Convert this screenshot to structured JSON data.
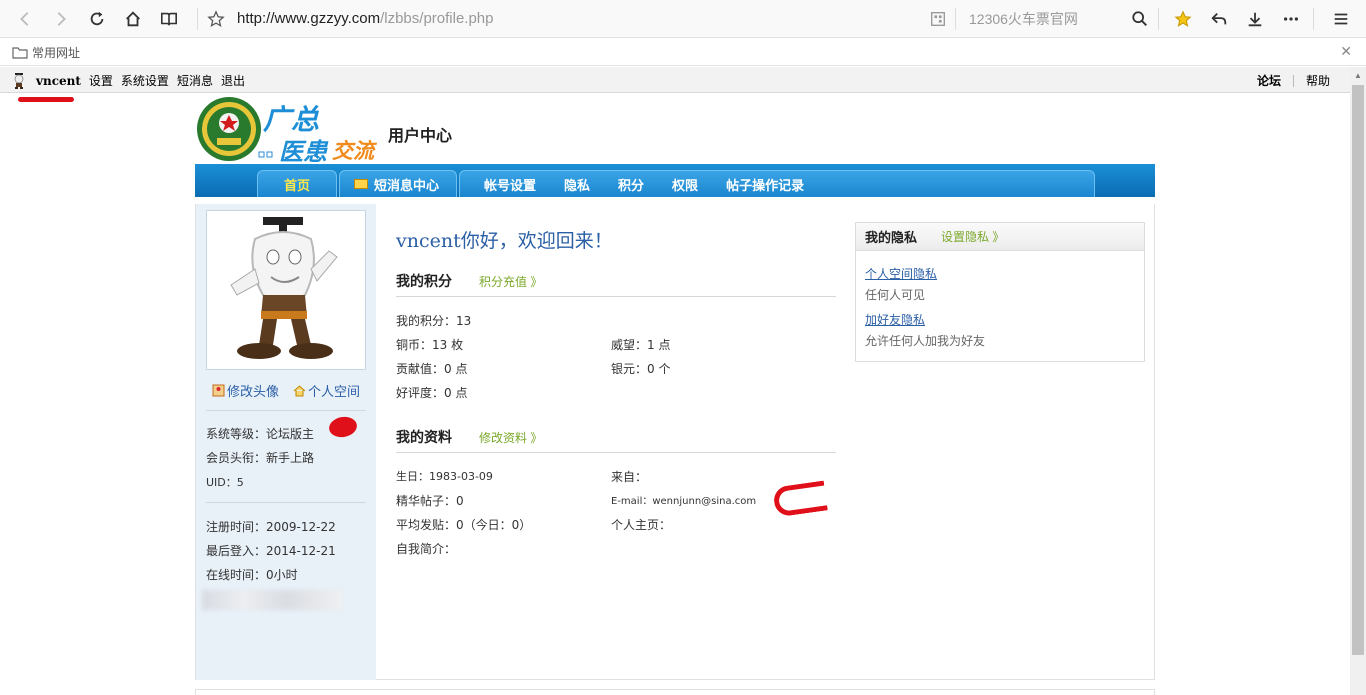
{
  "browser": {
    "url_host": "http://www.gzzyy.com",
    "url_path": "/lzbbs/profile.php",
    "search_placeholder": "12306火车票官网",
    "bookmark_folder": "常用网址"
  },
  "topbar": {
    "username": "vncent",
    "links": [
      "设置",
      "系统设置",
      "短消息",
      "退出"
    ],
    "right_links": [
      "论坛",
      "帮助"
    ]
  },
  "header": {
    "logo_text_1": "广总",
    "logo_text_2": "医患",
    "logo_text_3": "交流",
    "title": "用户中心"
  },
  "nav": {
    "home": "首页",
    "messages": "短消息中心",
    "tabs": [
      "帐号设置",
      "隐私",
      "积分",
      "权限",
      "帖子操作记录"
    ]
  },
  "sidebar": {
    "edit_avatar": "修改头像",
    "personal_space": "个人空间",
    "level": "系统等级：论坛版主",
    "member_title": "会员头衔：新手上路",
    "uid": "UID：5",
    "registered": "注册时间：2009-12-22",
    "last_login": "最后登入：2014-12-21",
    "online_time": "在线时间：0小时"
  },
  "content": {
    "welcome": "vncent你好，欢迎回来！",
    "points_title": "我的积分",
    "points_link": "积分充值 》",
    "my_points": "我的积分：13",
    "copper": "铜币：13 枚",
    "prestige": "威望：1 点",
    "contribution": "贡献值：0 点",
    "silver": "银元：0 个",
    "rating": "好评度：0 点",
    "profile_title": "我的资料",
    "profile_link": "修改资料 》",
    "birthday": "生日：1983-03-09",
    "from": "来自：",
    "digest": "精华帖子：0",
    "email": "E-mail：wennjunn@sina.com",
    "avg_posts": "平均发贴：0（今日：0）",
    "homepage": "个人主页：",
    "intro": "自我简介："
  },
  "privacy": {
    "title": "我的隐私",
    "link": "设置隐私 》",
    "items": [
      {
        "label": "个人空间隐私",
        "value": "任何人可见"
      },
      {
        "label": "加好友隐私",
        "value": "允许任何人加我为好友"
      }
    ]
  }
}
